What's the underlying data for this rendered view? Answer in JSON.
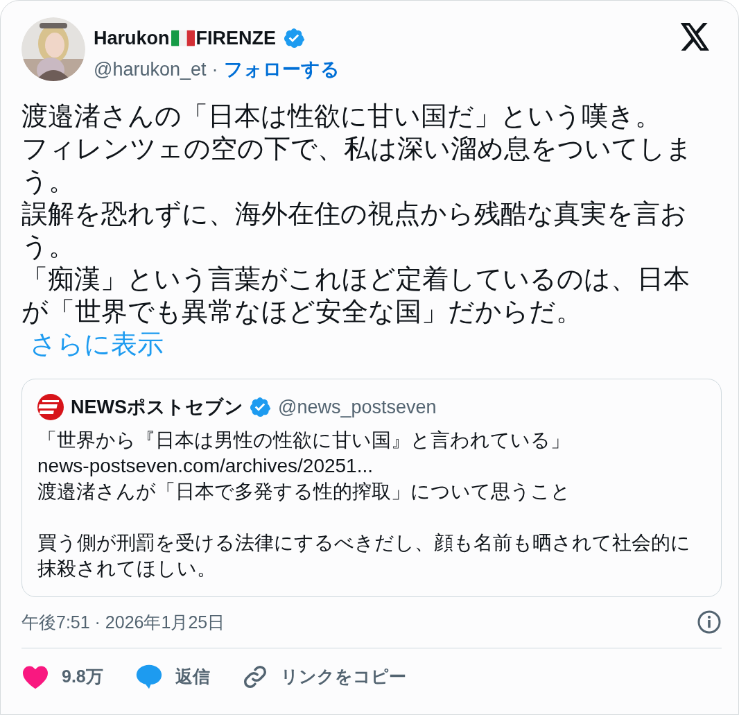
{
  "author": {
    "name_parts": [
      "Harukon",
      "FIRENZE"
    ],
    "verified": true,
    "handle": "@harukon_et",
    "separator": "·",
    "follow": "フォローする"
  },
  "text_lines": [
    "渡邉渚さんの「日本は性欲に甘い国だ」という嘆き。",
    "フィレンツェの空の下で、私は深い溜め息をついてしまう。",
    "誤解を恐れずに、海外在住の視点から残酷な真実を言おう。",
    "「痴漢」という言葉がこれほど定着しているのは、日本が「世界でも異常なほど安全な国」だからだ。"
  ],
  "show_more": "さらに表示",
  "quote": {
    "name": "NEWSポストセブン",
    "verified": true,
    "handle": "@news_postseven",
    "paragraphs": [
      [
        "「世界から『日本は男性の性欲に甘い国』と言われている」",
        "news-postseven.com/archives/20251...",
        "渡邉渚さんが「日本で多発する性的搾取」について思うこと"
      ],
      [
        "買う側が刑罰を受ける法律にするべきだし、顔も名前も晒されて社会的に抹殺されてほしい。"
      ]
    ]
  },
  "timestamp": "午後7:51 · 2026年1月25日",
  "actions": [
    {
      "kind": "like",
      "label": "9.8万"
    },
    {
      "kind": "reply",
      "label": "返信"
    },
    {
      "kind": "link",
      "label": "リンクをコピー"
    }
  ]
}
